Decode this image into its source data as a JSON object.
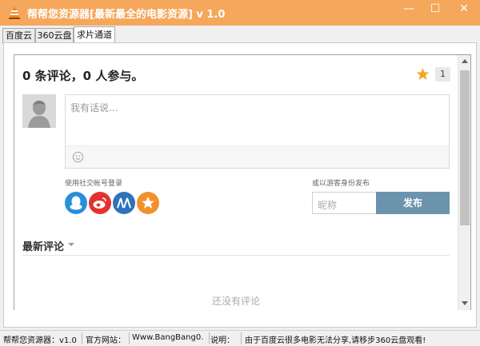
{
  "window": {
    "title": "帮帮您资源器[最新最全的电影资源] v 1.0",
    "minimize_glyph": "—",
    "maximize_glyph": "☐",
    "close_glyph": "✕",
    "icon": "app-cone-icon"
  },
  "tabs": [
    {
      "label": "百度云"
    },
    {
      "label": "360云盘"
    },
    {
      "label": "求片通道",
      "active": true
    }
  ],
  "comments": {
    "count_text": "0 条评论，0 人参与。",
    "star_count": "1",
    "input_placeholder": "我有话说...",
    "social_label": "使用社交帐号登录",
    "guest_label": "或以游客身份发布",
    "nickname_placeholder": "昵称",
    "publish_label": "发布",
    "latest_label": "最新评论",
    "empty_text": "还没有评论",
    "social_icons": [
      "qq-icon",
      "weibo-icon",
      "renren-icon",
      "star-icon"
    ]
  },
  "statusbar": {
    "app": "帮帮您资源器：v1.0",
    "site_label": "官方网站：",
    "site_url": "Www.BangBang0.",
    "note_label": "说明：",
    "note_text": "由于百度云很多电影无法分享,请移步360云盘观看!"
  },
  "colors": {
    "titlebar": "#f5a75c",
    "publish_button": "#6b93ad",
    "star": "#f5a623",
    "qq": "#2a8fd9",
    "weibo": "#e2322f",
    "renren": "#2e73ba",
    "star_social": "#f2912b"
  }
}
